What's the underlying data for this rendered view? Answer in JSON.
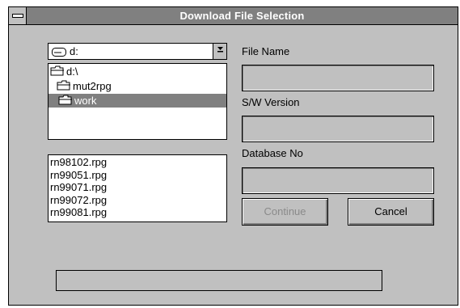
{
  "window": {
    "title": "Download File Selection"
  },
  "drive": {
    "selected": "d:"
  },
  "directories": [
    {
      "label": "d:\\",
      "selected": false
    },
    {
      "label": "mut2rpg",
      "selected": false
    },
    {
      "label": "work",
      "selected": true
    }
  ],
  "files": [
    "rn98102.rpg",
    "rn99051.rpg",
    "rn99071.rpg",
    "rn99072.rpg",
    "rn99081.rpg"
  ],
  "fields": {
    "file_name_label": "File Name",
    "sw_version_label": "S/W Version",
    "database_no_label": "Database No"
  },
  "buttons": {
    "continue": "Continue",
    "cancel": "Cancel"
  },
  "colors": {
    "titlebar": "#808080",
    "window": "#c0c0c0",
    "selection": "#808080"
  }
}
